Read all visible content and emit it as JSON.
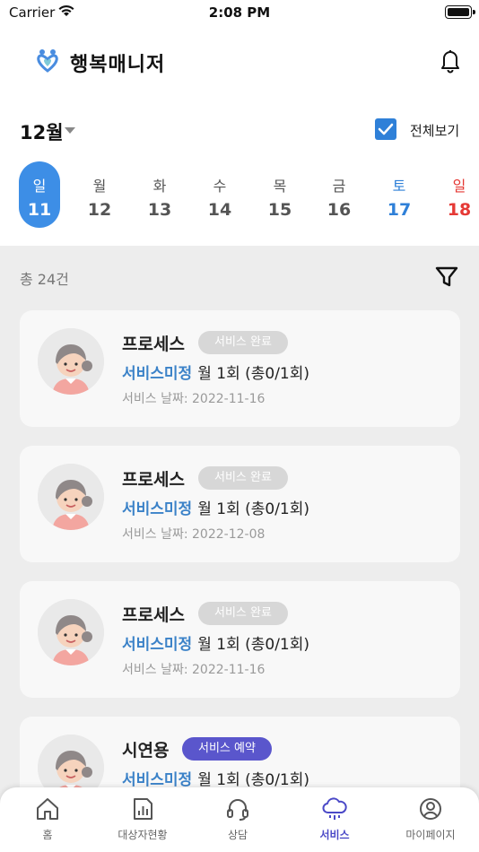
{
  "status_bar": {
    "carrier": "Carrier",
    "time": "2:08 PM"
  },
  "header": {
    "title": "행복매니저"
  },
  "calendar": {
    "month": "12월",
    "show_all_label": "전체보기",
    "show_all_checked": true,
    "days": [
      {
        "name": "일",
        "num": "11",
        "selected": true
      },
      {
        "name": "월",
        "num": "12"
      },
      {
        "name": "화",
        "num": "13"
      },
      {
        "name": "수",
        "num": "14"
      },
      {
        "name": "목",
        "num": "15"
      },
      {
        "name": "금",
        "num": "16"
      },
      {
        "name": "토",
        "num": "17"
      },
      {
        "name": "일",
        "num": "18"
      }
    ]
  },
  "list": {
    "total": "총 24건",
    "items": [
      {
        "name": "프로세스",
        "badge": "서비스 완료",
        "service_type": "서비스미정",
        "frequency": "월 1회 (총0/1회)",
        "date": "서비스 날짜: 2022-11-16"
      },
      {
        "name": "프로세스",
        "badge": "서비스 완료",
        "service_type": "서비스미정",
        "frequency": "월 1회 (총0/1회)",
        "date": "서비스 날짜: 2022-12-08"
      },
      {
        "name": "프로세스",
        "badge": "서비스 완료",
        "service_type": "서비스미정",
        "frequency": "월 1회 (총0/1회)",
        "date": "서비스 날짜: 2022-11-16"
      },
      {
        "name": "시연용",
        "badge": "서비스 예약",
        "service_type": "서비스미정",
        "frequency": "월 1회 (총0/1회)",
        "date": ""
      }
    ]
  },
  "tab_bar": {
    "tabs": [
      {
        "label": "홈",
        "icon": "home-icon"
      },
      {
        "label": "대상자현황",
        "icon": "chart-icon"
      },
      {
        "label": "상담",
        "icon": "headset-icon"
      },
      {
        "label": "서비스",
        "icon": "cloud-icon",
        "active": true
      },
      {
        "label": "마이페이지",
        "icon": "profile-icon"
      }
    ]
  },
  "colors": {
    "accent": "#3d8ee6",
    "service_type": "#3b82c8",
    "badge_done": "#d7d7d7",
    "badge_reserved": "#5a56cc",
    "tab_active": "#4b49c7",
    "saturday": "#2f80d8",
    "sunday": "#e53935"
  }
}
